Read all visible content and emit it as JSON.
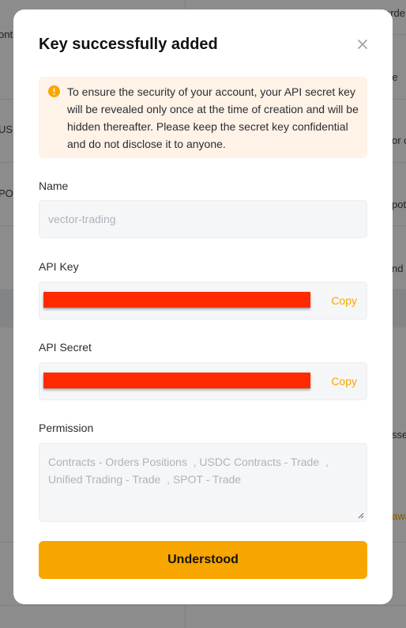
{
  "background": {
    "fragments": [
      "ont",
      "USDC",
      "POT",
      "orde",
      "e, le",
      "or c",
      "pot",
      "nd v",
      "sset",
      "awa"
    ]
  },
  "modal": {
    "title": "Key successfully added",
    "close_icon": "close-icon",
    "notice": {
      "icon": "warning-icon",
      "text": "To ensure the security of your account, your API secret key will be revealed only once at the time of creation and will be hidden thereafter. Please keep the secret key confidential and do not disclose it to anyone."
    },
    "name_field": {
      "label": "Name",
      "value": "vector-trading"
    },
    "api_key": {
      "label": "API Key",
      "copy_label": "Copy"
    },
    "api_secret": {
      "label": "API Secret",
      "copy_label": "Copy"
    },
    "permission": {
      "label": "Permission",
      "value": "Contracts - Orders Positions  , USDC Contracts - Trade  , Unified Trading - Trade  , SPOT - Trade"
    },
    "confirm_label": "Understood"
  },
  "colors": {
    "accent": "#f7a600",
    "notice_bg": "#fff2e6",
    "redaction": "#ff2a00"
  }
}
